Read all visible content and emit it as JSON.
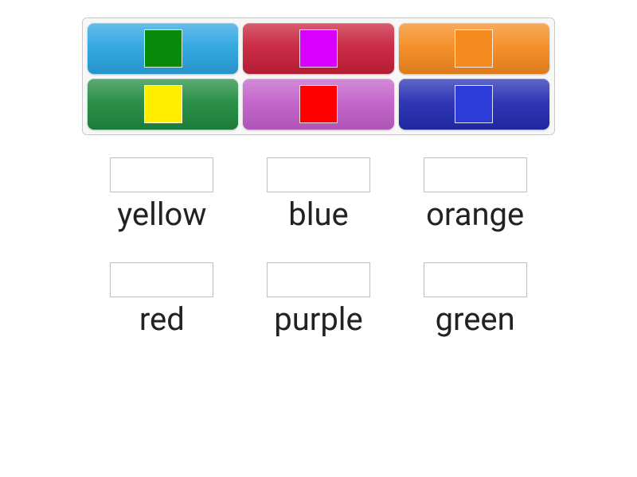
{
  "tile_panel": {
    "rows": 2,
    "cols": 3,
    "tiles": [
      {
        "name": "tile-blue",
        "bg": "#2aa4e0",
        "chip": "#0a8a0a"
      },
      {
        "name": "tile-red",
        "bg": "#c8203a",
        "chip": "#d900ff"
      },
      {
        "name": "tile-orange",
        "bg": "#f58a1f",
        "chip": "#f58a1f"
      },
      {
        "name": "tile-green",
        "bg": "#1f8a3f",
        "chip": "#ffee00"
      },
      {
        "name": "tile-purple",
        "bg": "#c15fc9",
        "chip": "#ff0000"
      },
      {
        "name": "tile-darkblue",
        "bg": "#232bb2",
        "chip": "#2d3bd8"
      }
    ]
  },
  "targets": [
    {
      "name": "target-yellow",
      "label": "yellow"
    },
    {
      "name": "target-blue",
      "label": "blue"
    },
    {
      "name": "target-orange",
      "label": "orange"
    },
    {
      "name": "target-red",
      "label": "red"
    },
    {
      "name": "target-purple",
      "label": "purple"
    },
    {
      "name": "target-green",
      "label": "green"
    }
  ]
}
